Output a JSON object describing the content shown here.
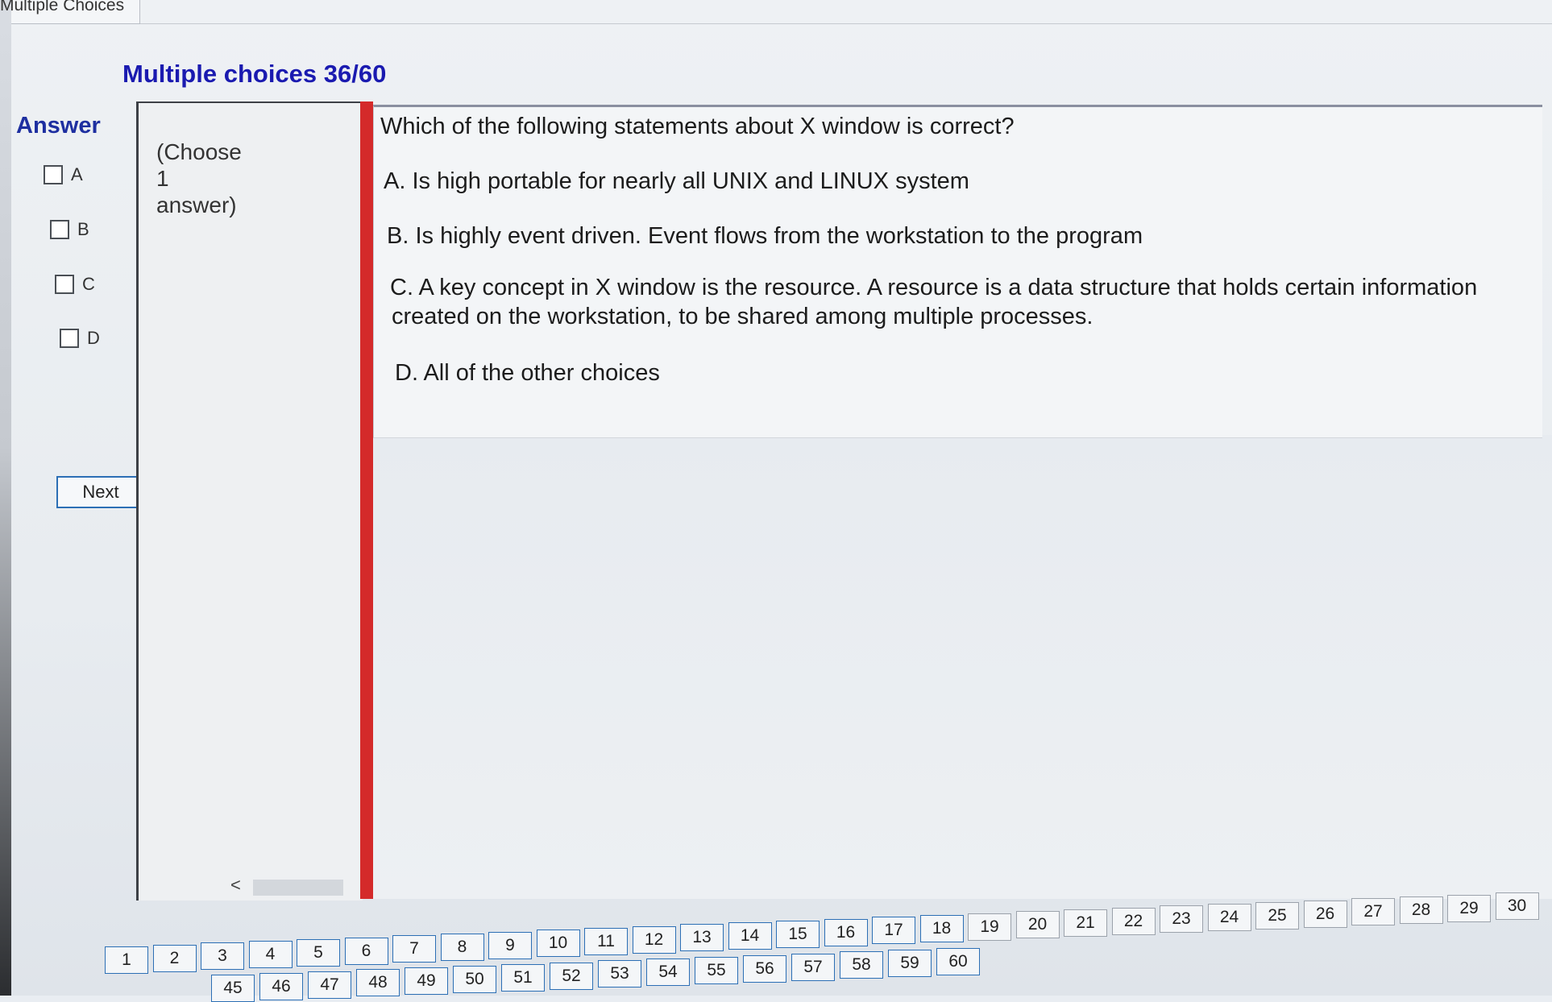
{
  "window": {
    "tab_label": "Multiple Choices"
  },
  "header": {
    "title": "Multiple choices 36/60"
  },
  "answer_panel": {
    "label": "Answer",
    "options": [
      {
        "label": "A",
        "checked": false
      },
      {
        "label": "B",
        "checked": false
      },
      {
        "label": "C",
        "checked": false
      },
      {
        "label": "D",
        "checked": false
      }
    ],
    "next_label": "Next"
  },
  "instruction": {
    "line1": "(Choose",
    "line2": "1",
    "line3": "answer)"
  },
  "scroll": {
    "left": "<",
    "right": ">"
  },
  "question": {
    "text": "Which of the following statements about X window is correct?",
    "choices": {
      "a": "A.  Is high portable for nearly all UNIX and LINUX system",
      "b": "B.  Is highly event driven. Event flows from the workstation to the program",
      "c1": "C.  A key concept in X window is the resource. A resource is a data structure that holds certain information",
      "c2": "created on the workstation, to be shared among multiple processes.",
      "d": "D.  All of the other choices"
    }
  },
  "pager": {
    "row1": [
      "1",
      "2",
      "3",
      "4",
      "5",
      "6",
      "7",
      "8",
      "9",
      "10",
      "11",
      "12",
      "13",
      "14",
      "15",
      "16",
      "17",
      "18",
      "19",
      "20",
      "21",
      "22",
      "23",
      "24",
      "25",
      "26",
      "27",
      "28",
      "29",
      "30"
    ],
    "row2": [
      "45",
      "46",
      "47",
      "48",
      "49",
      "50",
      "51",
      "52",
      "53",
      "54",
      "55",
      "56",
      "57",
      "58",
      "59",
      "60"
    ]
  }
}
